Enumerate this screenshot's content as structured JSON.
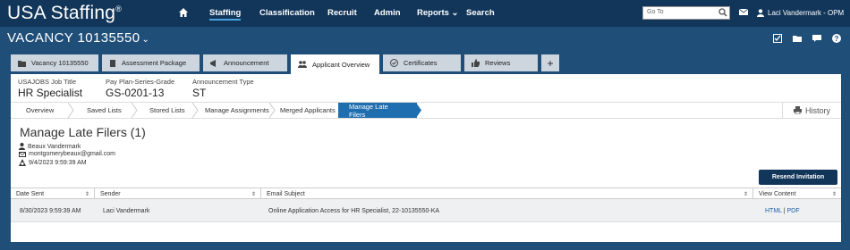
{
  "app": {
    "logo": "USA Staffing",
    "logo_mark": "®"
  },
  "nav": {
    "items": [
      "Staffing",
      "Classification",
      "Recruit",
      "Admin",
      "Reports",
      "Search"
    ],
    "reports_chevron": "⌄"
  },
  "goto": {
    "placeholder": "Go To"
  },
  "user": {
    "name": "Laci Vandermark - OPM"
  },
  "vacancy": {
    "title": "VACANCY 10135550",
    "chevron": "⌄"
  },
  "tabs": [
    {
      "label": "Vacancy 10135550"
    },
    {
      "label": "Assessment Package"
    },
    {
      "label": "Announcement"
    },
    {
      "label": "Applicant Overview"
    },
    {
      "label": "Certificates"
    },
    {
      "label": "Reviews"
    },
    {
      "label": "+"
    }
  ],
  "info": {
    "job_title_label": "USAJOBS Job Title",
    "job_title": "HR Specialist",
    "ppsg_label": "Pay Plan-Series-Grade",
    "ppsg": "GS-0201-13",
    "ann_type_label": "Announcement Type",
    "ann_type": "ST"
  },
  "steps": [
    "Overview",
    "Saved Lists",
    "Stored Lists",
    "Manage Assignments",
    "Merged Applicants",
    "Manage Late Filers"
  ],
  "history": {
    "label": "History"
  },
  "page": {
    "title": "Manage Late Filers (1)",
    "name": "Beaux Vandermark",
    "email": "montgomerybeaux@gmail.com",
    "date": "9/4/2023 9:59:39 AM",
    "resend_label": "Resend Invitation"
  },
  "table": {
    "headers": [
      "Date Sent",
      "Sender",
      "Email Subject",
      "View Content"
    ],
    "sort_glyph": "⇕",
    "rows": [
      {
        "date_sent": "8/30/2023 9:59:39 AM",
        "sender": "Laci Vandermark",
        "subject": "Online Application Access for HR Specialist, 22-10135550-KA",
        "html": "HTML",
        "sep": " | ",
        "pdf": "PDF"
      }
    ]
  },
  "colors": {
    "nav_bg": "#12365a",
    "page_bg": "#1f4e79",
    "accent": "#1f6fb0"
  }
}
